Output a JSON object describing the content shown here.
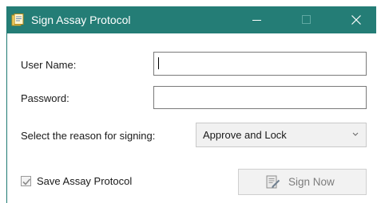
{
  "window": {
    "title": "Sign Assay Protocol",
    "icon": "document-icon",
    "controls": [
      "minimize-icon",
      "maximize-icon",
      "close-icon"
    ],
    "titlebar_color": "#247d76"
  },
  "form": {
    "username_label": "User Name:",
    "username_value": "",
    "password_label": "Password:",
    "password_value": "",
    "reason_label": "Select the reason for signing:",
    "reason_selected": "Approve and Lock",
    "save_label": "Save Assay Protocol",
    "save_checked": true,
    "sign_button_label": "Sign Now",
    "sign_button_icon": "sign-document-icon"
  }
}
